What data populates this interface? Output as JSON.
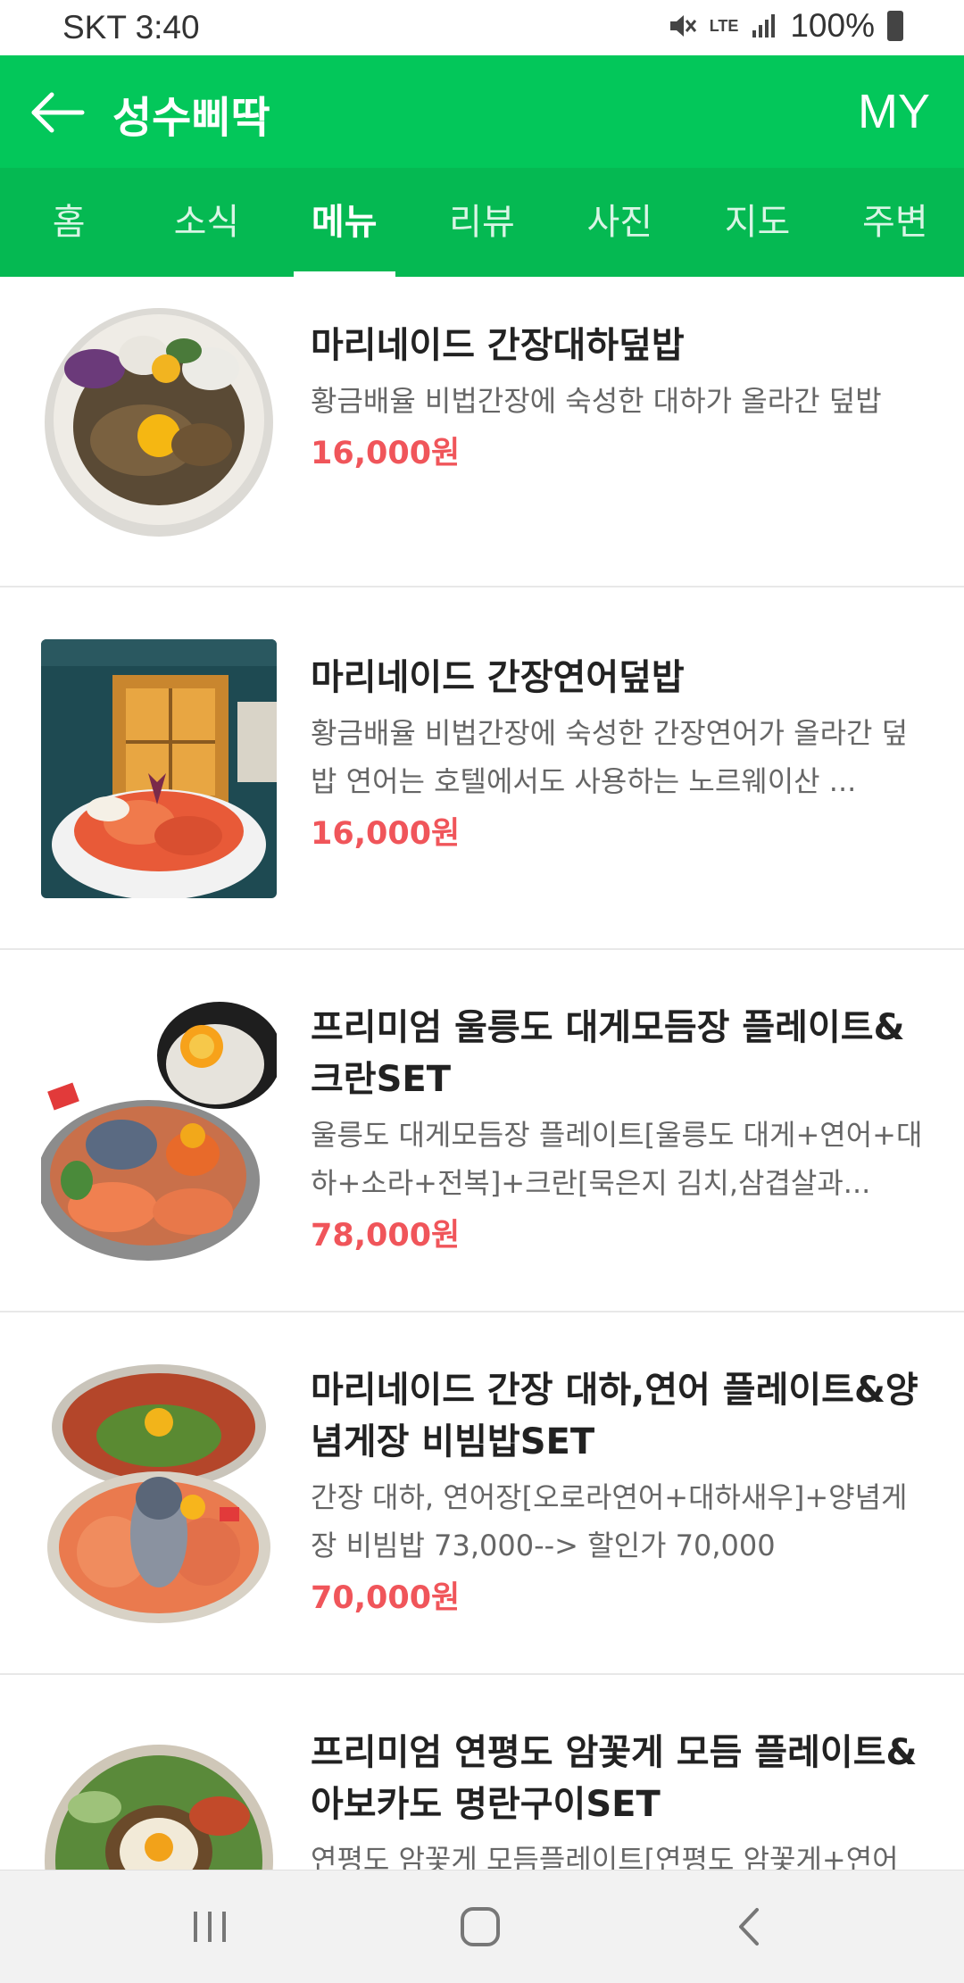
{
  "status": {
    "carrier_time": "SKT 3:40",
    "network": "LTE",
    "battery": "100%"
  },
  "app_bar": {
    "title": "성수삐딱",
    "my_label": "MY"
  },
  "tabs": [
    {
      "label": "홈"
    },
    {
      "label": "소식"
    },
    {
      "label": "메뉴"
    },
    {
      "label": "리뷰"
    },
    {
      "label": "사진"
    },
    {
      "label": "지도"
    },
    {
      "label": "주변"
    }
  ],
  "active_tab": "메뉴",
  "menu": [
    {
      "name": "마리네이드 간장대하덮밥",
      "desc": "황금배율 비법간장에 숙성한 대하가 올라간 덮밥",
      "price": "16,000원"
    },
    {
      "name": "마리네이드 간장연어덮밥",
      "desc": "황금배율 비법간장에 숙성한 간장연어가 올라간 덮밥 연어는 호텔에서도 사용하는 노르웨이산 ...",
      "price": "16,000원"
    },
    {
      "name": "프리미엄 울릉도 대게모듬장 플레이트&크란SET",
      "desc": "울릉도 대게모듬장 플레이트[울릉도 대게+연어+대하+소라+전복]+크란[묵은지 김치,삼겹살과...",
      "price": "78,000원"
    },
    {
      "name": "마리네이드 간장 대하,연어 플레이트&양념게장 비빔밥SET",
      "desc": "간장 대하, 연어장[오로라연어+대하새우]+양념게장 비빔밥 73,000--> 할인가 70,000",
      "price": "70,000원"
    },
    {
      "name": "프리미엄 연평도 암꽃게 모듬 플레이트&아보카도 명란구이SET",
      "desc": "연평도 암꽃게 모듬플레이트[연평도 암꽃게+연어",
      "price": ""
    }
  ],
  "colors": {
    "app_bar": "#03c75a",
    "tab_bar": "#05b952",
    "price": "#f0555a"
  }
}
